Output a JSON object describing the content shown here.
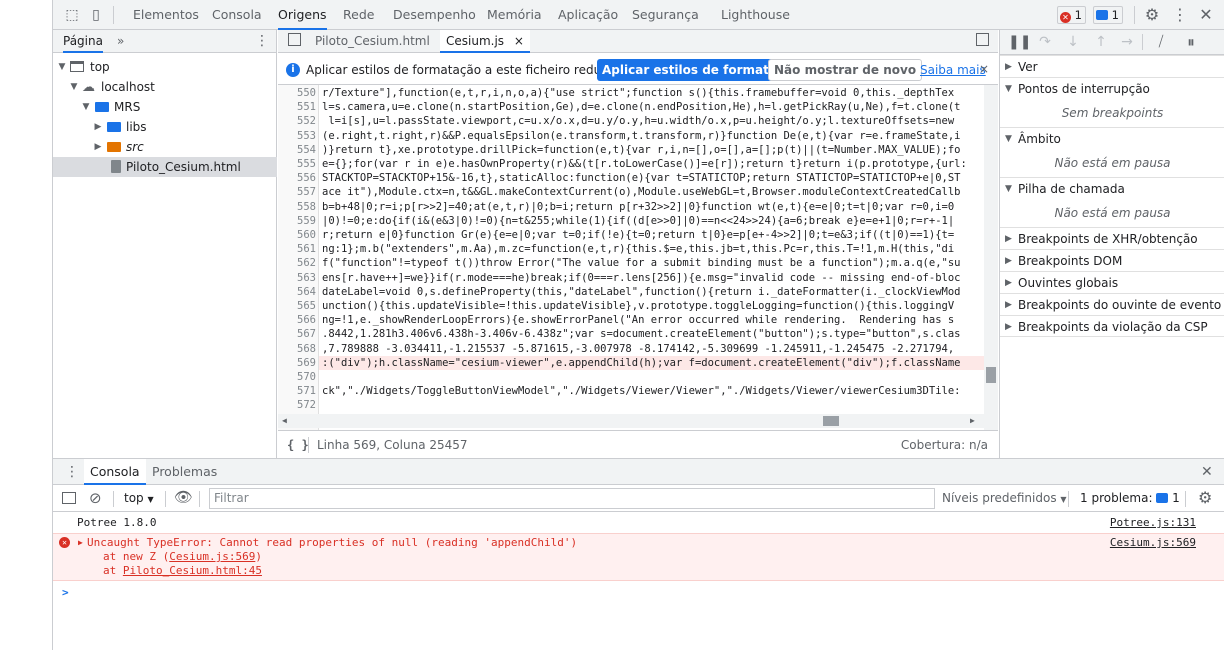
{
  "top_bar": {
    "tabs": [
      "Elementos",
      "Consola",
      "Origens",
      "Rede",
      "Desempenho",
      "Memória",
      "Aplicação",
      "Segurança",
      "Lighthouse"
    ],
    "active_tab": "Origens",
    "error_count": "1",
    "message_count": "1"
  },
  "navigator": {
    "tab_label": "Página",
    "more_label": "»",
    "tree": [
      {
        "label": "top",
        "depth": 0,
        "expanded": true,
        "icon": "frame-icon"
      },
      {
        "label": "localhost",
        "depth": 1,
        "expanded": true,
        "icon": "cloud-icon"
      },
      {
        "label": "MRS",
        "depth": 2,
        "expanded": true,
        "icon": "folder-icon"
      },
      {
        "label": "libs",
        "depth": 3,
        "expanded": false,
        "icon": "folder-icon"
      },
      {
        "label": "src",
        "depth": 3,
        "expanded": false,
        "icon": "folder-icon"
      },
      {
        "label": "Piloto_Cesium.html",
        "depth": 3,
        "selected": true,
        "icon": "file-icon"
      }
    ]
  },
  "editor": {
    "tabs": [
      {
        "label": "Piloto_Cesium.html",
        "active": false
      },
      {
        "label": "Cesium.js",
        "active": true,
        "close": "×"
      }
    ],
    "infobar": {
      "message": "Aplicar estilos de formatação a este ficheiro reduzido?",
      "primary_button": "Aplicar estilos de formatação",
      "secondary_button": "Não mostrar de novo",
      "learn_more": "Saiba mais",
      "close": "×"
    },
    "lines": [
      {
        "n": "550",
        "code": "r/Texture\"],function(e,t,r,i,n,o,a){\"use strict\";function s(){this.framebuffer=void 0,this._depthTex"
      },
      {
        "n": "551",
        "code": "l=s.camera,u=e.clone(n.startPosition,Ge),d=e.clone(n.endPosition,He),h=l.getPickRay(u,Ne),f=t.clone(t"
      },
      {
        "n": "552",
        "code": " l=i[s],u=l.passState.viewport,c=u.x/o.x,d=u.y/o.y,h=u.width/o.x,p=u.height/o.y;l.textureOffsets=new"
      },
      {
        "n": "553",
        "code": "(e.right,t.right,r)&&P.equalsEpsilon(e.transform,t.transform,r)}function De(e,t){var r=e.frameState,i"
      },
      {
        "n": "554",
        "code": ")}return t},xe.prototype.drillPick=function(e,t){var r,i,n=[],o=[],a=[];p(t)||(t=Number.MAX_VALUE);fo"
      },
      {
        "n": "555",
        "code": "e={};for(var r in e)e.hasOwnProperty(r)&&(t[r.toLowerCase()]=e[r]);return t}return i(p.prototype,{url:"
      },
      {
        "n": "556",
        "code": "STACKTOP=STACKTOP+15&-16,t},staticAlloc:function(e){var t=STATICTOP;return STATICTOP=STATICTOP+e|0,ST"
      },
      {
        "n": "557",
        "code": "ace it\"),Module.ctx=n,t&&GL.makeContextCurrent(o),Module.useWebGL=t,Browser.moduleContextCreatedCallb"
      },
      {
        "n": "558",
        "code": "b=b+48|0;r=i;p[r>>2]=40;at(e,t,r)|0;b=i;return p[r+32>>2]|0}function wt(e,t){e=e|0;t=t|0;var r=0,i=0"
      },
      {
        "n": "559",
        "code": "|0)!=0;e:do{if(i&(e&3|0)!=0){n=t&255;while(1){if((d[e>>0]|0)==n<<24>>24){a=6;break e}e=e+1|0;r=r+-1|"
      },
      {
        "n": "560",
        "code": "r;return e|0}function Gr(e){e=e|0;var t=0;if(!e){t=0;return t|0}e=p[e+-4>>2]|0;t=e&3;if((t|0)==1){t="
      },
      {
        "n": "561",
        "code": "ng:1};m.b(\"extenders\",m.Aa),m.zc=function(e,t,r){this.$=e,this.jb=t,this.Pc=r,this.T=!1,m.H(this,\"di"
      },
      {
        "n": "562",
        "code": "f(\"function\"!=typeof t())throw Error(\"The value for a submit binding must be a function\");m.a.q(e,\"su"
      },
      {
        "n": "563",
        "code": "ens[r.have++]=we}}if(r.mode===he)break;if(0===r.lens[256]){e.msg=\"invalid code -- missing end-of-bloc"
      },
      {
        "n": "564",
        "code": "dateLabel=void 0,s.defineProperty(this,\"dateLabel\",function(){return i._dateFormatter(i._clockViewMod"
      },
      {
        "n": "565",
        "code": "unction(){this.updateVisible=!this.updateVisible},v.prototype.toggleLogging=function(){this.loggingV"
      },
      {
        "n": "566",
        "code": "ng=!1,e._showRenderLoopErrors){e.showErrorPanel(\"An error occurred while rendering.  Rendering has s"
      },
      {
        "n": "567",
        "code": ".8442,1.281h3.406v6.438h-3.406v-6.438z\";var s=document.createElement(\"button\");s.type=\"button\",s.clas"
      },
      {
        "n": "568",
        "code": ",7.789888 -3.034411,-1.215537 -5.871615,-3.007978 -8.174142,-5.309699 -1.245911,-1.245475 -2.271794,"
      },
      {
        "n": "569",
        "code": ":(\"div\");h.className=\"cesium-viewer\",e.appendChild(h);var f=document.createElement(\"div\");f.className"
      },
      {
        "n": "570",
        "code": ""
      },
      {
        "n": "571",
        "code": "ck\",\"./Widgets/ToggleButtonViewModel\",\"./Widgets/Viewer/Viewer\",\"./Widgets/Viewer/viewerCesium3DTile:"
      },
      {
        "n": "572",
        "code": ""
      }
    ],
    "status_position": "Linha 569, Coluna 25457",
    "status_coverage": "Cobertura: n/a",
    "format_icon": "{ }"
  },
  "debugger": {
    "sections": [
      {
        "title": "Ver",
        "expanded": false
      },
      {
        "title": "Pontos de interrupção",
        "expanded": true,
        "body": "Sem breakpoints"
      },
      {
        "title": "Âmbito",
        "expanded": true,
        "body": "Não está em pausa"
      },
      {
        "title": "Pilha de chamada",
        "expanded": true,
        "body": "Não está em pausa"
      },
      {
        "title": "Breakpoints de XHR/obtenção",
        "expanded": false
      },
      {
        "title": "Breakpoints DOM",
        "expanded": false
      },
      {
        "title": "Ouvintes globais",
        "expanded": false
      },
      {
        "title": "Breakpoints do ouvinte de evento",
        "expanded": false
      },
      {
        "title": "Breakpoints da violação da CSP",
        "expanded": false
      }
    ]
  },
  "drawer": {
    "tabs": [
      "Consola",
      "Problemas"
    ],
    "active_tab": "Consola",
    "context": "top",
    "filter_placeholder": "Filtrar",
    "levels": "Níveis predefinidos",
    "problems": "1 problema:",
    "problems_count": "1"
  },
  "console": {
    "messages": [
      {
        "type": "log",
        "text": "Potree 1.8.0",
        "source": "Potree.js:131"
      },
      {
        "type": "error",
        "text": "Uncaught TypeError: Cannot read properties of null (reading 'appendChild')",
        "source": "Cesium.js:569",
        "stack": [
          {
            "prefix": "at new Z (",
            "link": "Cesium.js:569",
            "suffix": ")"
          },
          {
            "prefix": "at ",
            "link": "Piloto_Cesium.html:45",
            "suffix": ""
          }
        ]
      }
    ],
    "prompt": ">"
  },
  "colors": {
    "accent": "#1a73e8",
    "error": "#d93025",
    "error_bg": "#fff0f0",
    "folder_orange": "#e37400"
  }
}
